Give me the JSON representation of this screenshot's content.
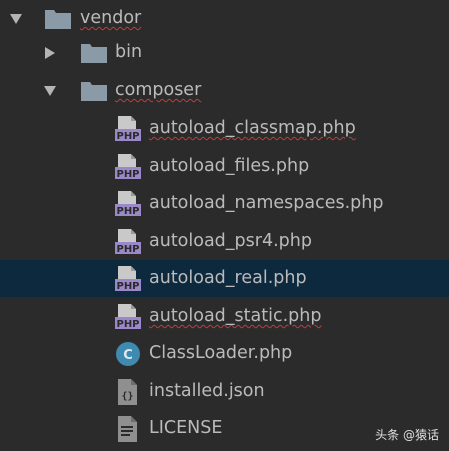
{
  "tree": {
    "vendor": {
      "label": "vendor",
      "icon": "folder-icon",
      "expanded": true
    },
    "bin": {
      "label": "bin",
      "icon": "folder-icon",
      "expanded": false
    },
    "composer": {
      "label": "composer",
      "icon": "folder-icon",
      "expanded": true
    },
    "files": [
      {
        "label": "autoload_classmap.php",
        "icon": "php-file-icon"
      },
      {
        "label": "autoload_files.php",
        "icon": "php-file-icon"
      },
      {
        "label": "autoload_namespaces.php",
        "icon": "php-file-icon"
      },
      {
        "label": "autoload_psr4.php",
        "icon": "php-file-icon"
      },
      {
        "label": "autoload_real.php",
        "icon": "php-file-icon",
        "selected": true
      },
      {
        "label": "autoload_static.php",
        "icon": "php-file-icon"
      },
      {
        "label": "ClassLoader.php",
        "icon": "php-class-icon"
      },
      {
        "label": "installed.json",
        "icon": "json-file-icon"
      },
      {
        "label": "LICENSE",
        "icon": "text-file-icon"
      }
    ]
  },
  "colors": {
    "background": "#2b2b2b",
    "selection": "#0d293e",
    "text": "#bbbbbb",
    "folder": "#8a9aa6",
    "php_badge": "#9b88c8",
    "class_icon": "#3f8ab0",
    "error_squiggle": "#bc3f3c"
  },
  "watermark": "头条 @猿话"
}
